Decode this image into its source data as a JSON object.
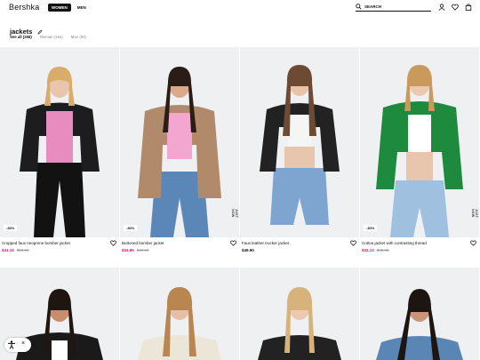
{
  "header": {
    "logo": "Bershka",
    "tabs": [
      {
        "label": "WOMEN",
        "active": true
      },
      {
        "label": "MEN",
        "active": false
      }
    ],
    "search_label": "SEARCH",
    "icons": [
      "user-icon",
      "heart-icon",
      "bag-icon"
    ]
  },
  "page": {
    "title": "jackets",
    "filters": [
      {
        "label": "See all (258)",
        "active": true
      },
      {
        "label": "Woman (164)",
        "active": false
      },
      {
        "label": "Man (94)",
        "active": false
      }
    ]
  },
  "products": [
    {
      "name": "Cropped faux neoprene bomber jacket",
      "price": "$41.15",
      "old_price": "$59.90",
      "badge": "-30%",
      "tag": "",
      "sale": true,
      "top": "#e88cbf",
      "jacket": "#1d1d1f",
      "bottom": "#121212",
      "hair": "#d8ad6b"
    },
    {
      "name": "Buttoned bomber jacket",
      "price": "$34.95",
      "old_price": "$49.90",
      "badge": "-30%",
      "tag": "JUST NOW",
      "sale": true,
      "top": "#f3a6cf",
      "jacket": "#b08a6a",
      "bottom": "#5b87b8",
      "hair": "#2a1d17"
    },
    {
      "name": "Faux leather trucker jacket",
      "price": "$49.90",
      "old_price": "",
      "badge": "",
      "tag": "",
      "sale": false,
      "top": "#f5f5f5",
      "jacket": "#222222",
      "bottom": "#7da5d0",
      "hair": "#6c4a34"
    },
    {
      "name": "Cotton jacket with contrasting thread",
      "price": "$32.13",
      "old_price": "$45.90",
      "badge": "-30%",
      "tag": "JUST NOW",
      "sale": true,
      "top": "#ffffff",
      "jacket": "#1e8a3e",
      "bottom": "#9fc0df",
      "hair": "#c99a5c"
    },
    {
      "name": "",
      "price": "",
      "old_price": "",
      "badge": "",
      "tag": "",
      "sale": false,
      "top": "#ffffff",
      "jacket": "#1a1a1a",
      "bottom": "#1a1a1a",
      "hair": "#1f1612"
    },
    {
      "name": "",
      "price": "",
      "old_price": "",
      "badge": "",
      "tag": "",
      "sale": false,
      "top": "#ffffff",
      "jacket": "#ece6d8",
      "bottom": "#ece6d8",
      "hair": "#b98550"
    },
    {
      "name": "",
      "price": "",
      "old_price": "",
      "badge": "",
      "tag": "",
      "sale": false,
      "top": "#ffffff",
      "jacket": "#222222",
      "bottom": "#222222",
      "hair": "#d7b27a"
    },
    {
      "name": "",
      "price": "",
      "old_price": "",
      "badge": "",
      "tag": "",
      "sale": false,
      "top": "#ffffff",
      "jacket": "#5a86b6",
      "bottom": "#5a86b6",
      "hair": "#1c1512"
    }
  ],
  "accessibility_widget": {
    "icon": "accessibility-icon",
    "close": "×"
  }
}
